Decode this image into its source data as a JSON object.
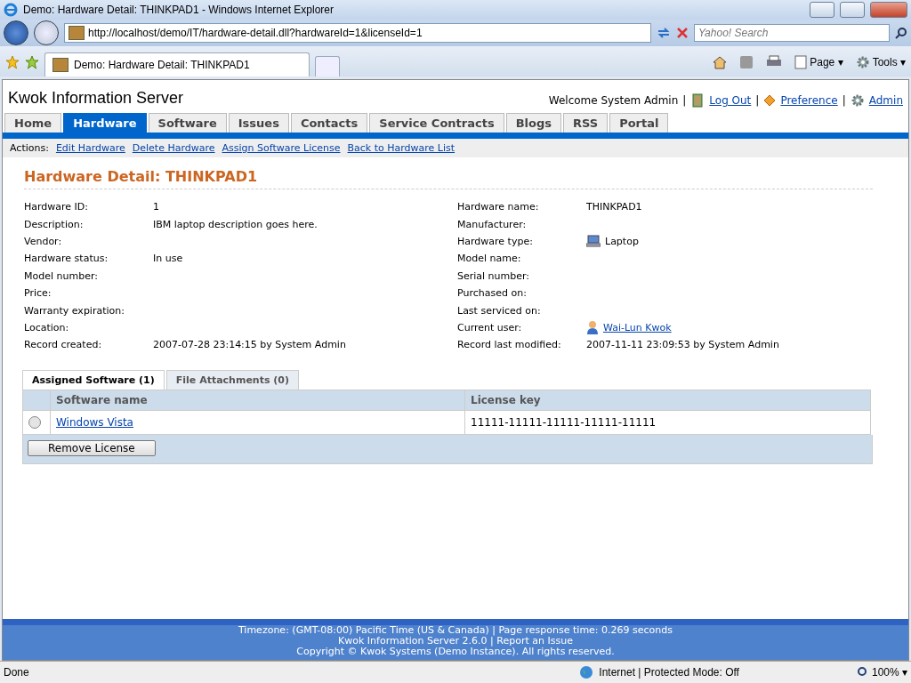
{
  "window": {
    "title": "Demo: Hardware Detail: THINKPAD1 - Windows Internet Explorer"
  },
  "address_bar": {
    "url": "http://localhost/demo/IT/hardware-detail.dll?hardwareId=1&licenseId=1"
  },
  "search": {
    "placeholder": "Yahoo! Search"
  },
  "browser_tabs": [
    {
      "label": "Demo: Hardware Detail: THINKPAD1",
      "selected": true
    }
  ],
  "command_bar": [
    {
      "label": "Page",
      "caret": "▾"
    },
    {
      "label": "Tools",
      "caret": "▾"
    }
  ],
  "site": {
    "title": "Kwok Information Server",
    "welcome": "Welcome System Admin",
    "separator": "|",
    "links": [
      {
        "label": "Log Out"
      },
      {
        "label": "Preference"
      },
      {
        "label": "Admin"
      }
    ]
  },
  "nav_tabs": [
    {
      "label": "Home",
      "selected": false
    },
    {
      "label": "Hardware",
      "selected": true
    },
    {
      "label": "Software",
      "selected": false
    },
    {
      "label": "Issues",
      "selected": false
    },
    {
      "label": "Contacts",
      "selected": false
    },
    {
      "label": "Service Contracts",
      "selected": false
    },
    {
      "label": "Blogs",
      "selected": false
    },
    {
      "label": "RSS",
      "selected": false
    },
    {
      "label": "Portal",
      "selected": false
    }
  ],
  "actions": {
    "label": "Actions:",
    "links": [
      "Edit Hardware",
      "Delete Hardware",
      "Assign Software License",
      "Back to Hardware List"
    ]
  },
  "heading": "Hardware Detail: THINKPAD1",
  "fields_left": [
    {
      "label": "Hardware ID:",
      "value": "1",
      "kind": "text"
    },
    {
      "label": "Description:",
      "value": "IBM laptop description goes here.",
      "kind": "text"
    },
    {
      "label": "Vendor:"
    },
    {
      "label": "Hardware status:",
      "value": "In use",
      "kind": "text"
    },
    {
      "label": "Model number:"
    },
    {
      "label": "Price:"
    },
    {
      "label": "Warranty expiration:"
    },
    {
      "label": "Location:"
    },
    {
      "label": "Record created:",
      "value": "2007-07-28 23:14:15 by System Admin",
      "kind": "text"
    }
  ],
  "fields_right": [
    {
      "label": "Hardware name:",
      "value": "THINKPAD1",
      "kind": "text"
    },
    {
      "label": "Manufacturer:"
    },
    {
      "label": "Hardware type:",
      "value": "Laptop",
      "kind": "laptop"
    },
    {
      "label": "Model name:"
    },
    {
      "label": "Serial number:"
    },
    {
      "label": "Purchased on:"
    },
    {
      "label": "Last serviced on:"
    },
    {
      "label": "Current user:",
      "value": "Wai-Lun Kwok",
      "kind": "user"
    },
    {
      "label": "Record last modified:",
      "value": "2007-11-11 23:09:53 by System Admin",
      "kind": "text"
    }
  ],
  "detail_tabs": [
    {
      "label": "Assigned Software (1)",
      "selected": true
    },
    {
      "label": "File Attachments (0)",
      "selected": false
    }
  ],
  "table": {
    "columns": [
      "Software name",
      "License key"
    ],
    "rows": [
      {
        "selected": false,
        "software": "Windows Vista",
        "key": "11111-11111-11111-11111-11111"
      }
    ]
  },
  "remove_button": "Remove License",
  "footer": {
    "lines": [
      "Timezone: (GMT-08:00) Pacific Time (US & Canada) | Page response time: 0.269 seconds",
      "Kwok Information Server 2.6.0 | Report an Issue",
      "Copyright © Kwok Systems (Demo Instance). All rights reserved."
    ]
  },
  "status_bar": {
    "status": "Done",
    "zone": "Internet | Protected Mode: Off",
    "zoom": "100%",
    "zoom_caret": "▾"
  }
}
